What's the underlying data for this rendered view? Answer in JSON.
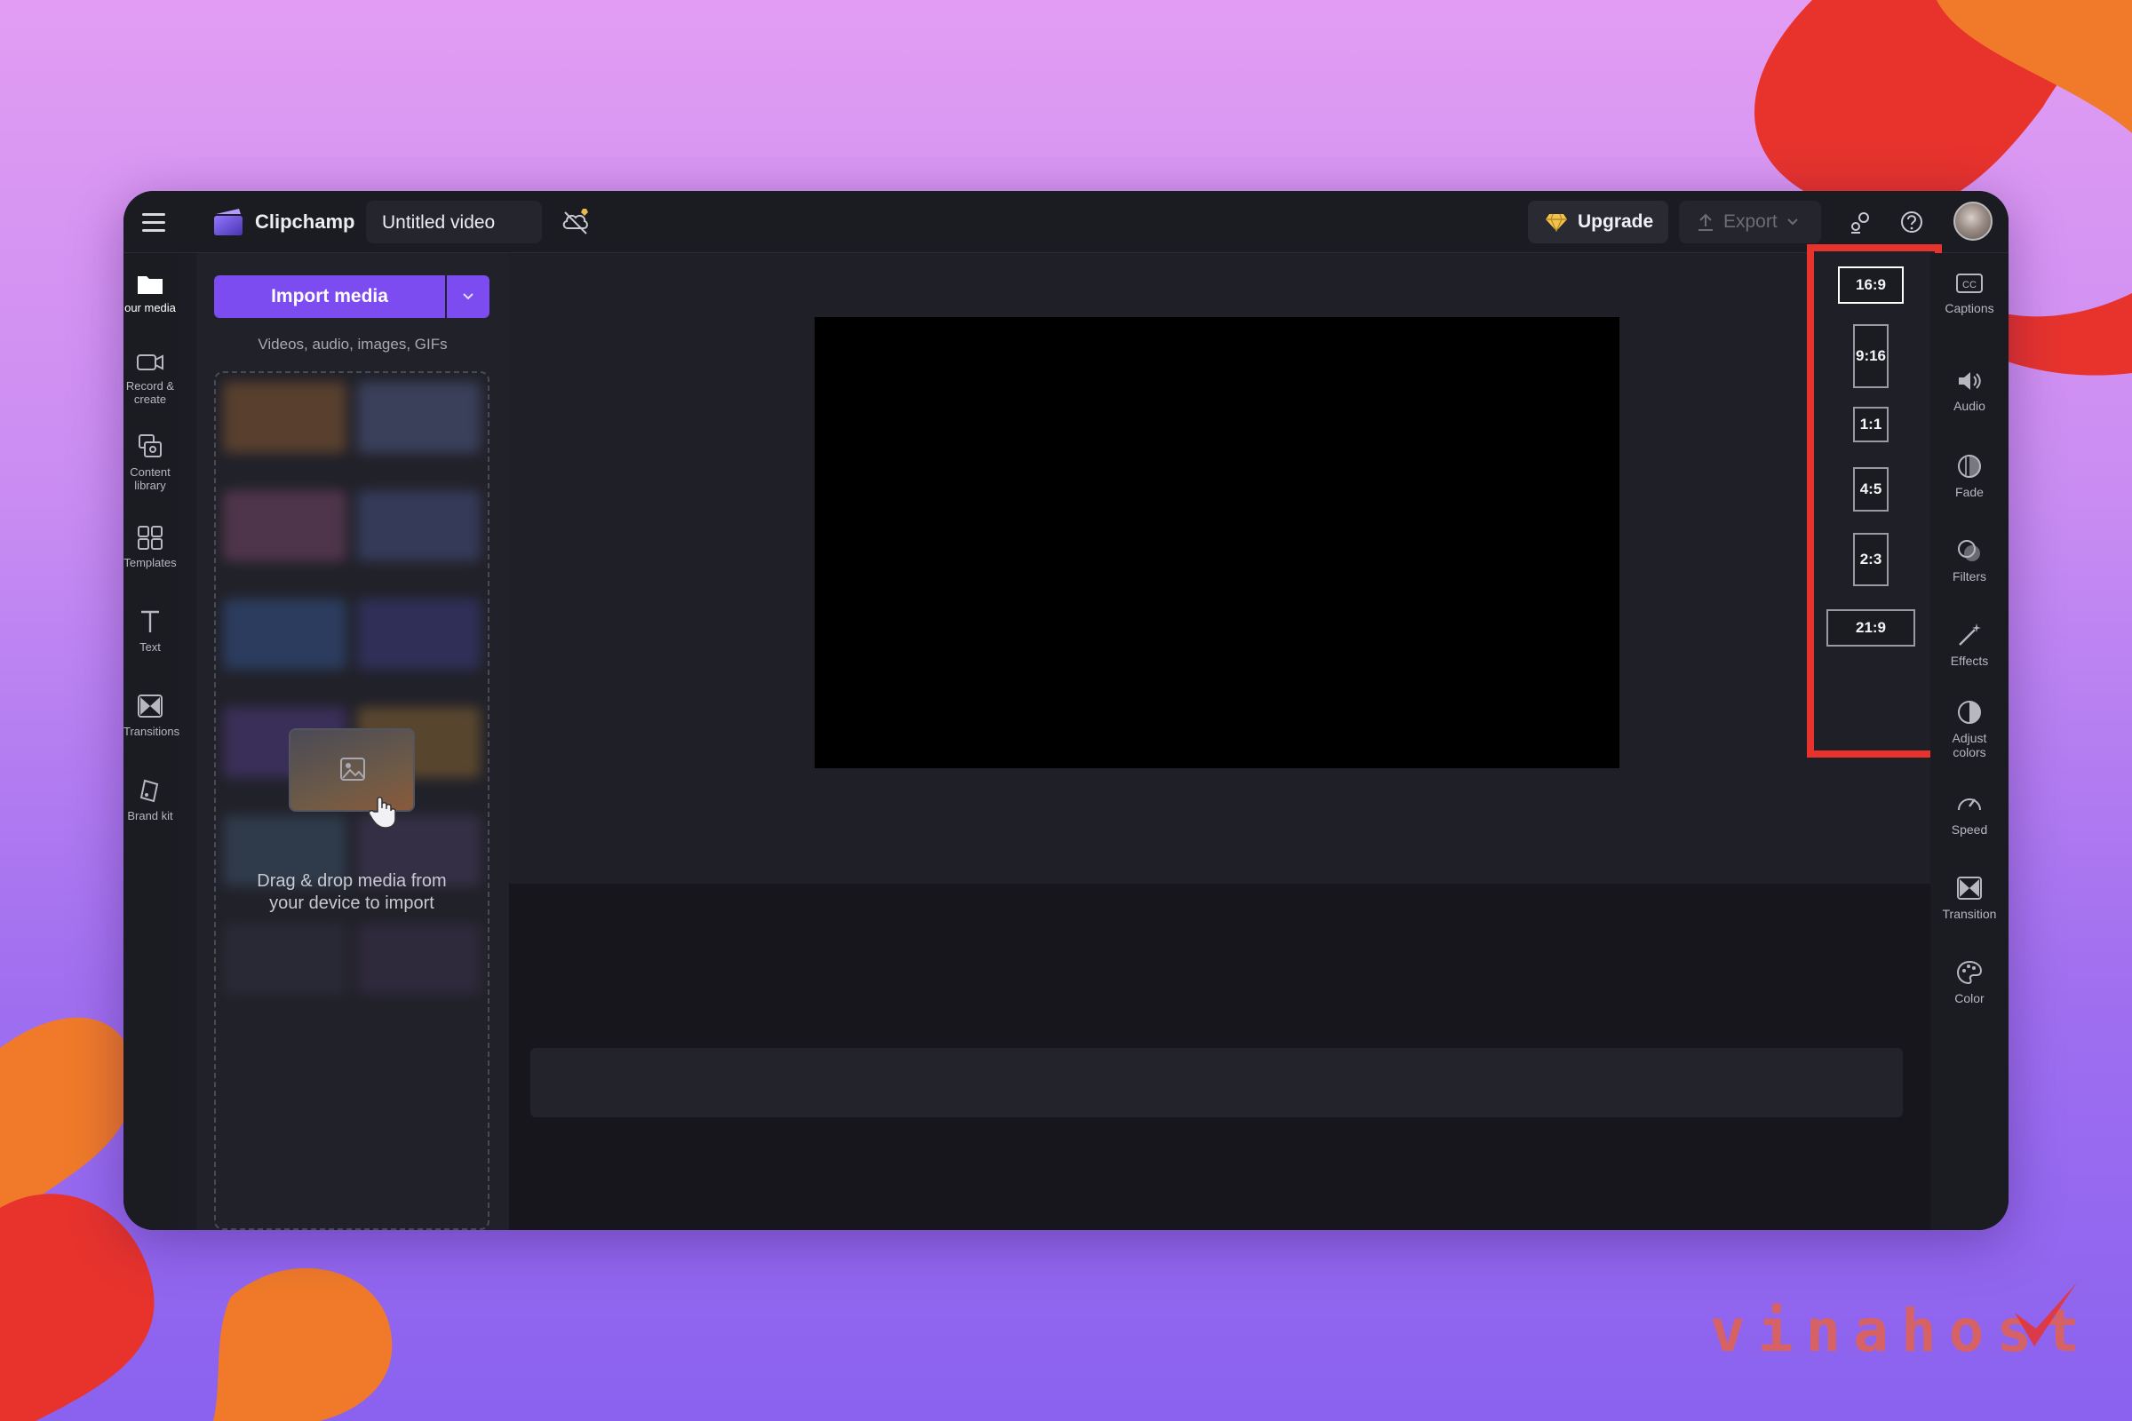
{
  "colors": {
    "accent": "#7d4cf0",
    "highlight_box": "#e8332d",
    "preview_canvas": "#000000"
  },
  "topbar": {
    "brand": "Clipchamp",
    "project_title": "Untitled video",
    "upgrade_label": "Upgrade",
    "export_label": "Export",
    "icons": [
      "menu-icon",
      "clipchamp-logo",
      "cloud-off-icon",
      "diamond-icon",
      "share-icon",
      "help-icon",
      "avatar"
    ]
  },
  "left_rail": [
    {
      "label": "our media",
      "icon": "folder-icon",
      "active": true
    },
    {
      "label": "Record &",
      "label2": "create",
      "icon": "camera-icon"
    },
    {
      "label": "Content",
      "label2": "library",
      "icon": "library-icon"
    },
    {
      "label": "Templates",
      "icon": "templates-icon"
    },
    {
      "label": "Text",
      "icon": "text-icon"
    },
    {
      "label": "Transitions",
      "icon": "transitions-icon"
    },
    {
      "label": "Brand kit",
      "icon": "brand-kit-icon"
    }
  ],
  "media_panel": {
    "import_label": "Import media",
    "hint": "Videos, audio, images, GIFs",
    "drop_line1": "Drag & drop media from",
    "drop_line2": "your device to import"
  },
  "aspect_ratios": [
    {
      "label": "16:9",
      "selected": true
    },
    {
      "label": "9:16"
    },
    {
      "label": "1:1"
    },
    {
      "label": "4:5"
    },
    {
      "label": "2:3"
    },
    {
      "label": "21:9"
    }
  ],
  "right_rail": [
    {
      "label": "Captions",
      "icon": "captions-icon"
    },
    {
      "label": "Audio",
      "icon": "speaker-icon"
    },
    {
      "label": "Fade",
      "icon": "fade-icon"
    },
    {
      "label": "Filters",
      "icon": "filters-icon"
    },
    {
      "label": "Effects",
      "icon": "magic-wand-icon"
    },
    {
      "label": "Adjust",
      "label2": "colors",
      "icon": "adjust-colors-icon"
    },
    {
      "label": "Speed",
      "icon": "speed-icon"
    },
    {
      "label": "Transition",
      "icon": "transition-icon"
    },
    {
      "label": "Color",
      "icon": "palette-icon"
    }
  ],
  "watermark": "vinahost"
}
